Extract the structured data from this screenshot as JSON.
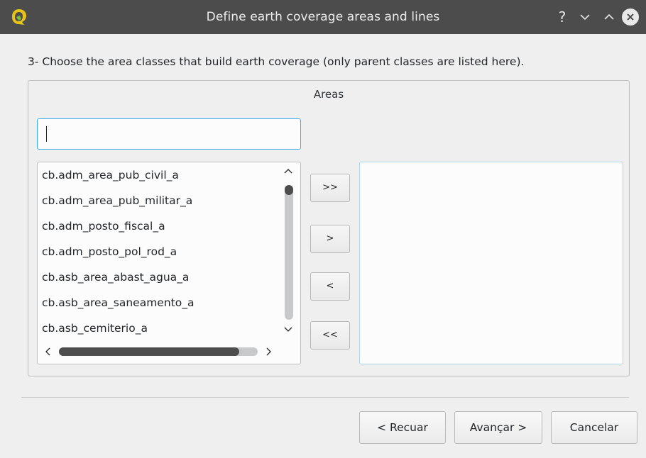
{
  "window": {
    "title": "Define earth coverage areas and lines",
    "app_icon": "qgis-logo-icon",
    "controls": {
      "help": "?",
      "minimize": "chevron-down-icon",
      "maximize": "chevron-up-icon",
      "close": "close-icon"
    }
  },
  "wizard": {
    "instruction": "3- Choose the area classes that build earth coverage (only parent classes are listed here).",
    "group_title": "Areas",
    "filter": {
      "value": ""
    },
    "available_classes": [
      "cb.adm_area_pub_civil_a",
      "cb.adm_area_pub_militar_a",
      "cb.adm_posto_fiscal_a",
      "cb.adm_posto_pol_rod_a",
      "cb.asb_area_abast_agua_a",
      "cb.asb_area_saneamento_a",
      "cb.asb_cemiterio_a"
    ],
    "selected_classes": [],
    "move_buttons": {
      "add_all": ">>",
      "add_one": ">",
      "remove_one": "<",
      "remove_all": "<<"
    }
  },
  "footer": {
    "back_label": "< Recuar",
    "next_label": "Avançar >",
    "cancel_label": "Cancelar"
  },
  "colors": {
    "titlebar": "#4c4c4c",
    "focus_border": "#3daee9",
    "background": "#efefef"
  }
}
